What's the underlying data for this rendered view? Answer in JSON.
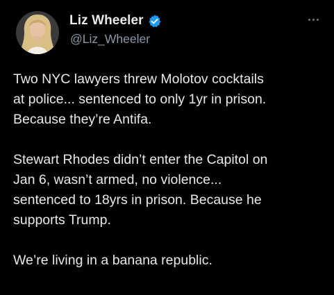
{
  "author": {
    "name": "Liz Wheeler",
    "handle": "@Liz_Wheeler",
    "verified": true,
    "avatar_icon": "profile-photo"
  },
  "menu_icon": "more-options-icon",
  "tweet": {
    "paragraphs": [
      {
        "lines": [
          "Two NYC lawyers threw Molotov cocktails",
          "at police... sentenced to only 1yr in prison.",
          "Because they’re Antifa."
        ]
      },
      {
        "lines": [
          "Stewart Rhodes didn’t enter the Capitol on",
          "Jan 6, wasn’t armed, no violence...",
          "sentenced to 18yrs in prison. Because he",
          "supports Trump."
        ]
      },
      {
        "lines": [
          "We’re living in a banana republic."
        ]
      }
    ]
  },
  "colors": {
    "background": "#000000",
    "text_primary": "#e7e9ea",
    "text_secondary": "#8b98a5",
    "verified_badge": "#1d9bf0"
  }
}
